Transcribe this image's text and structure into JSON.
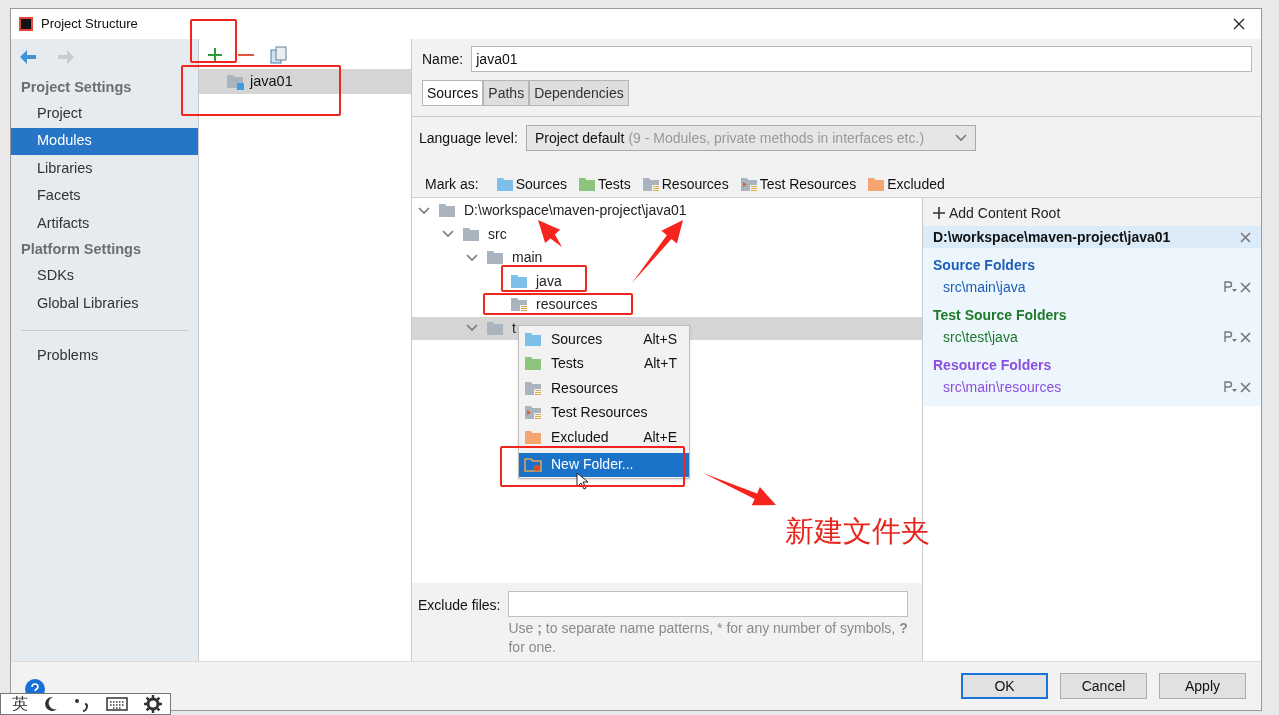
{
  "window": {
    "title": "Project Structure"
  },
  "sidebar": {
    "sections": [
      {
        "heading": "Project Settings",
        "items": [
          {
            "label": "Project",
            "selected": false
          },
          {
            "label": "Modules",
            "selected": true
          },
          {
            "label": "Libraries",
            "selected": false
          },
          {
            "label": "Facets",
            "selected": false
          },
          {
            "label": "Artifacts",
            "selected": false
          }
        ]
      },
      {
        "heading": "Platform Settings",
        "items": [
          {
            "label": "SDKs",
            "selected": false
          },
          {
            "label": "Global Libraries",
            "selected": false
          }
        ]
      }
    ],
    "extra_items": [
      {
        "label": "Problems",
        "selected": false
      }
    ]
  },
  "modules": [
    {
      "name": "java01",
      "selected": true
    }
  ],
  "name_field": {
    "label": "Name:",
    "value": "java01"
  },
  "tabs": [
    {
      "label": "Sources",
      "selected": true
    },
    {
      "label": "Paths",
      "selected": false
    },
    {
      "label": "Dependencies",
      "selected": false
    }
  ],
  "language_level": {
    "label": "Language level:",
    "value": "Project default",
    "hint": "(9 - Modules, private methods in interfaces etc.)"
  },
  "mark_as": {
    "label": "Mark as:",
    "items": [
      {
        "label": "Sources",
        "kind": "sources"
      },
      {
        "label": "Tests",
        "kind": "tests"
      },
      {
        "label": "Resources",
        "kind": "resources"
      },
      {
        "label": "Test Resources",
        "kind": "test_resources"
      },
      {
        "label": "Excluded",
        "kind": "excluded"
      }
    ]
  },
  "tree": [
    {
      "label": "D:\\workspace\\maven-project\\java01",
      "kind": "folder",
      "expanded": true,
      "selected": false,
      "children": [
        {
          "label": "src",
          "kind": "folder",
          "expanded": true,
          "selected": false,
          "children": [
            {
              "label": "main",
              "kind": "folder",
              "expanded": true,
              "selected": false,
              "children": [
                {
                  "label": "java",
                  "kind": "sources",
                  "selected": false
                },
                {
                  "label": "resources",
                  "kind": "resources",
                  "selected": false
                }
              ]
            },
            {
              "label": "t",
              "kind": "folder",
              "expanded": true,
              "selected": true
            }
          ]
        }
      ]
    }
  ],
  "context_menu": [
    {
      "label": "Sources",
      "shortcut": "Alt+S",
      "kind": "sources",
      "selected": false
    },
    {
      "label": "Tests",
      "shortcut": "Alt+T",
      "kind": "tests",
      "selected": false
    },
    {
      "label": "Resources",
      "kind": "resources",
      "selected": false
    },
    {
      "label": "Test Resources",
      "kind": "test_resources",
      "selected": false
    },
    {
      "label": "Excluded",
      "shortcut": "Alt+E",
      "kind": "excluded",
      "selected": false
    },
    {
      "label": "New Folder...",
      "kind": "new_folder",
      "selected": true
    }
  ],
  "content_root": {
    "add_label": "Add Content Root",
    "path": "D:\\workspace\\maven-project\\java01",
    "groups": [
      {
        "title": "Source Folders",
        "color": "#1d5fb8",
        "folders": [
          "src\\main\\java"
        ]
      },
      {
        "title": "Test Source Folders",
        "color": "#1d7a2a",
        "folders": [
          "src\\test\\java"
        ]
      },
      {
        "title": "Resource Folders",
        "color": "#8a4fe0",
        "folders": [
          "src\\main\\resources"
        ]
      }
    ]
  },
  "exclude_files": {
    "label": "Exclude files:",
    "hint": "Use **;** to separate name patterns, * for any number of symbols, **?** for one."
  },
  "buttons": [
    {
      "label": "OK",
      "default": true
    },
    {
      "label": "Cancel",
      "default": false
    },
    {
      "label": "Apply",
      "default": false
    }
  ],
  "callout": "新建文件夹",
  "ime_bar": {
    "label": "英"
  }
}
